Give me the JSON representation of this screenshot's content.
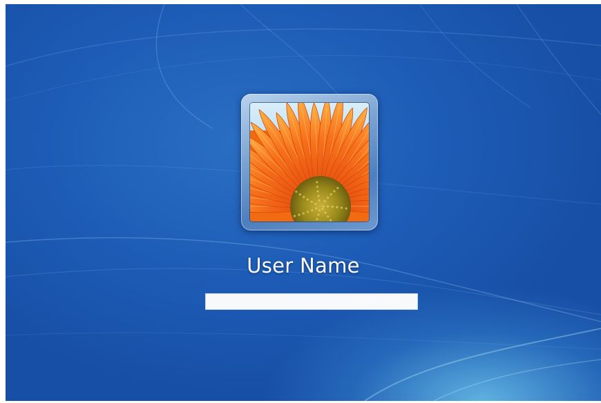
{
  "login_screen": {
    "user_name": "User Name",
    "password_field": {
      "value": "",
      "placeholder": ""
    },
    "avatar_icon": "orange-flower-icon"
  },
  "colors": {
    "background_blue": "#1d5cb6",
    "glow_cyan": "#78d2f5",
    "frame_blue": "#7fa6d3",
    "text_white": "#ffffff",
    "input_white": "#f8f9fb"
  }
}
